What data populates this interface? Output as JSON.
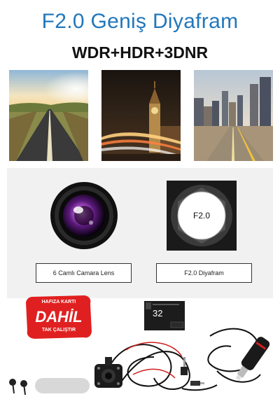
{
  "header": {
    "title": "F2.0 Geniş Diyafram",
    "subtitle": "WDR+HDR+3DNR"
  },
  "features": {
    "lens_label": "6 Camlı Camara Lens",
    "aperture_label": "F2.0 Diyafram",
    "aperture_text": "F2.0"
  },
  "badge": {
    "top": "HAFIZA KARTI",
    "main": "DAHİL",
    "bottom": "TAK ÇALIŞTIR",
    "color": "#e02020"
  },
  "sdcard": {
    "capacity": "32"
  },
  "colors": {
    "headline": "#2277bb",
    "badge": "#e02020"
  }
}
